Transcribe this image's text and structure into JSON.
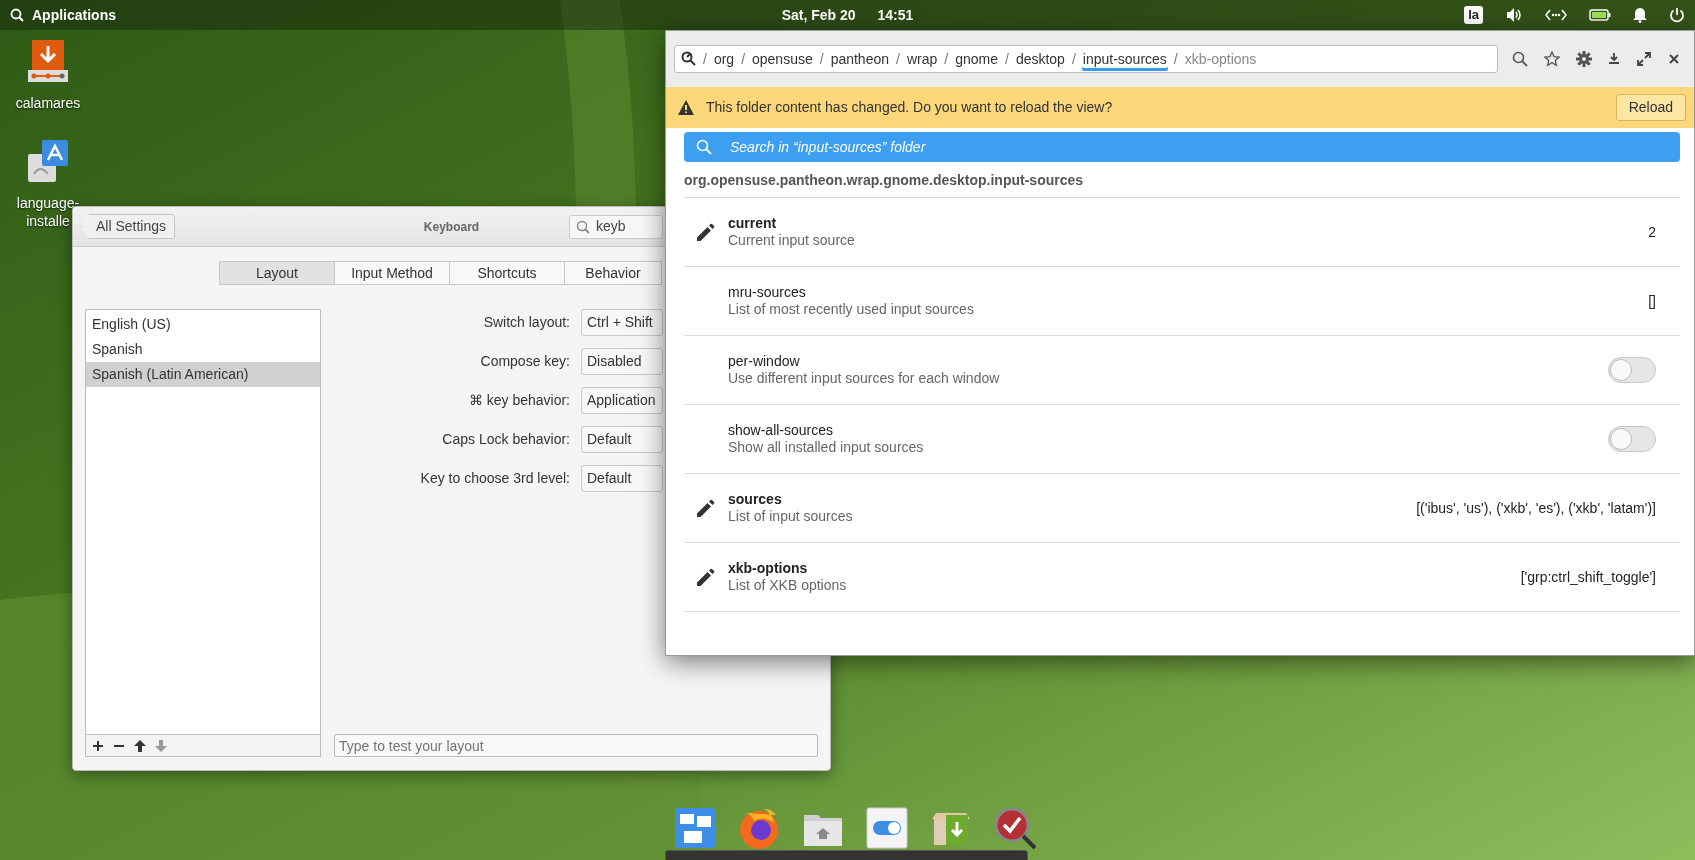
{
  "top_panel": {
    "applications": "Applications",
    "date": "Sat, Feb 20",
    "time": "14:51",
    "keyboard_indicator": "la"
  },
  "desktop_icons": [
    {
      "kind": "installer",
      "label": "calamares"
    },
    {
      "kind": "language",
      "label": "language-installe"
    }
  ],
  "keyboard_window": {
    "back_button": "All Settings",
    "title": "Keyboard",
    "search": {
      "value": "keyb"
    },
    "tabs": [
      {
        "label": "Layout",
        "selected": true
      },
      {
        "label": "Input Method",
        "selected": false
      },
      {
        "label": "Shortcuts",
        "selected": false
      },
      {
        "label": "Behavior",
        "selected": false
      }
    ],
    "layouts": [
      {
        "label": "English (US)",
        "selected": false
      },
      {
        "label": "Spanish",
        "selected": false
      },
      {
        "label": "Spanish (Latin American)",
        "selected": true
      }
    ],
    "list_toolbar": [
      {
        "kind": "add",
        "disabled": false
      },
      {
        "kind": "remove",
        "disabled": false
      },
      {
        "kind": "up",
        "disabled": false
      },
      {
        "kind": "down",
        "disabled": true
      }
    ],
    "settings": [
      {
        "label": "Switch layout:",
        "value": "Ctrl + Shift"
      },
      {
        "label": "Compose key:",
        "value": "Disabled"
      },
      {
        "label": "⌘ key behavior:",
        "value": "Application"
      },
      {
        "label": "Caps Lock behavior:",
        "value": "Default"
      },
      {
        "label": "Key to choose 3rd level:",
        "value": "Default"
      }
    ],
    "test_field": {
      "placeholder": "Type to test your layout"
    }
  },
  "dconf_window": {
    "pathbar": {
      "separator": "/",
      "segments": [
        {
          "label": "org",
          "selected": false,
          "dimmed": false
        },
        {
          "label": "opensuse",
          "selected": false,
          "dimmed": false
        },
        {
          "label": "pantheon",
          "selected": false,
          "dimmed": false
        },
        {
          "label": "wrap",
          "selected": false,
          "dimmed": false
        },
        {
          "label": "gnome",
          "selected": false,
          "dimmed": false
        },
        {
          "label": "desktop",
          "selected": false,
          "dimmed": false
        },
        {
          "label": "input-sources",
          "selected": true,
          "dimmed": false
        },
        {
          "label": "xkb-options",
          "selected": false,
          "dimmed": true
        }
      ]
    },
    "infobar": {
      "message": "This folder content has changed. Do you want to reload the view?",
      "button": "Reload"
    },
    "search": {
      "placeholder": "Search in “input-sources” folder"
    },
    "folder_path": "org.opensuse.pantheon.wrap.gnome.desktop.input-sources",
    "keys": [
      {
        "name": "current",
        "description": "Current input source",
        "modified": true,
        "kind": "text",
        "value": "2"
      },
      {
        "name": "mru-sources",
        "description": "List of most recently used input sources",
        "modified": false,
        "kind": "text",
        "value": "[]"
      },
      {
        "name": "per-window",
        "description": "Use different input sources for each window",
        "modified": false,
        "kind": "toggle",
        "on": false
      },
      {
        "name": "show-all-sources",
        "description": "Show all installed input sources",
        "modified": false,
        "kind": "toggle",
        "on": false
      },
      {
        "name": "sources",
        "description": "List of input sources",
        "modified": true,
        "kind": "text",
        "value": "[('ibus', 'us'), ('xkb', 'es'), ('xkb', 'latam')]"
      },
      {
        "name": "xkb-options",
        "description": "List of XKB options",
        "modified": true,
        "kind": "text",
        "value": "['grp:ctrl_shift_toggle']"
      }
    ]
  }
}
